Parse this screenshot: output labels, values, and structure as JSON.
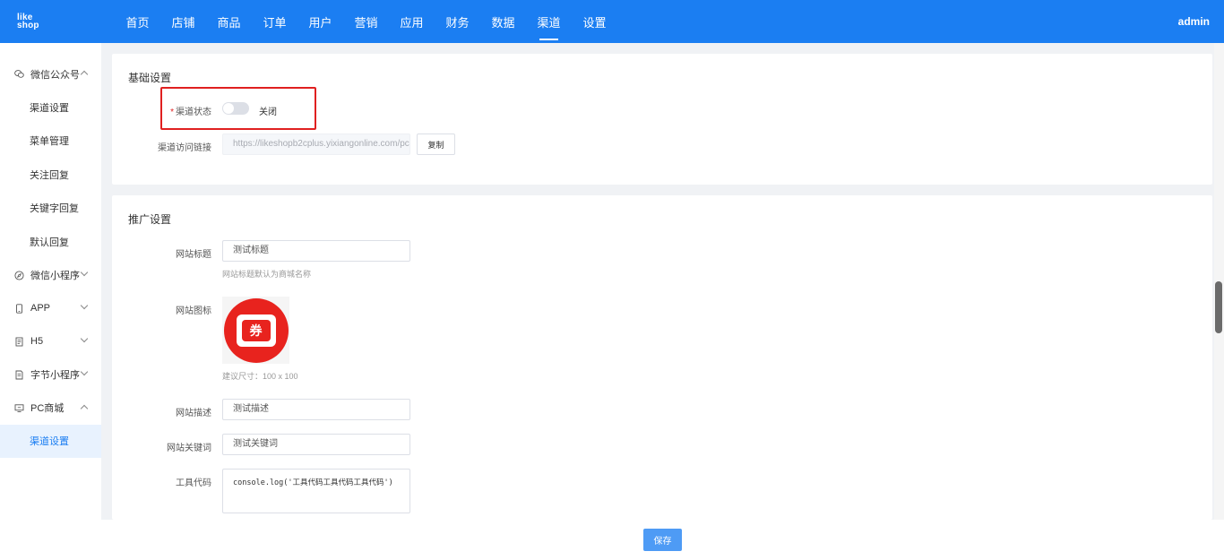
{
  "brand": {
    "line1": "like",
    "line2": "shop"
  },
  "nav": {
    "items": [
      "首页",
      "店铺",
      "商品",
      "订单",
      "用户",
      "营销",
      "应用",
      "财务",
      "数据",
      "渠道",
      "设置"
    ],
    "active_index": 9,
    "user": "admin"
  },
  "sidebar": {
    "wechat_official": "微信公众号",
    "wechat_items": [
      "渠道设置",
      "菜单管理",
      "关注回复",
      "关键字回复",
      "默认回复"
    ],
    "mini_program": "微信小程序",
    "app": "APP",
    "h5": "H5",
    "bytedance": "字节小程序",
    "pc_mall": "PC商城",
    "pc_items": [
      "渠道设置"
    ]
  },
  "basic": {
    "title": "基础设置",
    "status_label": "渠道状态",
    "status_value": "关闭",
    "status_on": false,
    "link_label": "渠道访问链接",
    "link_value": "https://likeshopb2cplus.yixiangonline.com/pc",
    "copy_label": "复制"
  },
  "promo": {
    "title": "推广设置",
    "site_title_label": "网站标题",
    "site_title_value": "测试标题",
    "site_title_hint": "网站标题默认为商城名称",
    "site_icon_label": "网站图标",
    "icon_glyph": "券",
    "icon_hint": "建议尺寸：100 x 100",
    "site_desc_label": "网站描述",
    "site_desc_value": "测试描述",
    "site_keywords_label": "网站关键词",
    "site_keywords_value": "测试关键词",
    "tool_code_label": "工具代码",
    "tool_code_value": "console.log('工具代码工具代码工具代码')"
  },
  "footer": {
    "save_label": "保存"
  },
  "colors": {
    "primary": "#1b7ef2",
    "highlight": "#e02020"
  }
}
